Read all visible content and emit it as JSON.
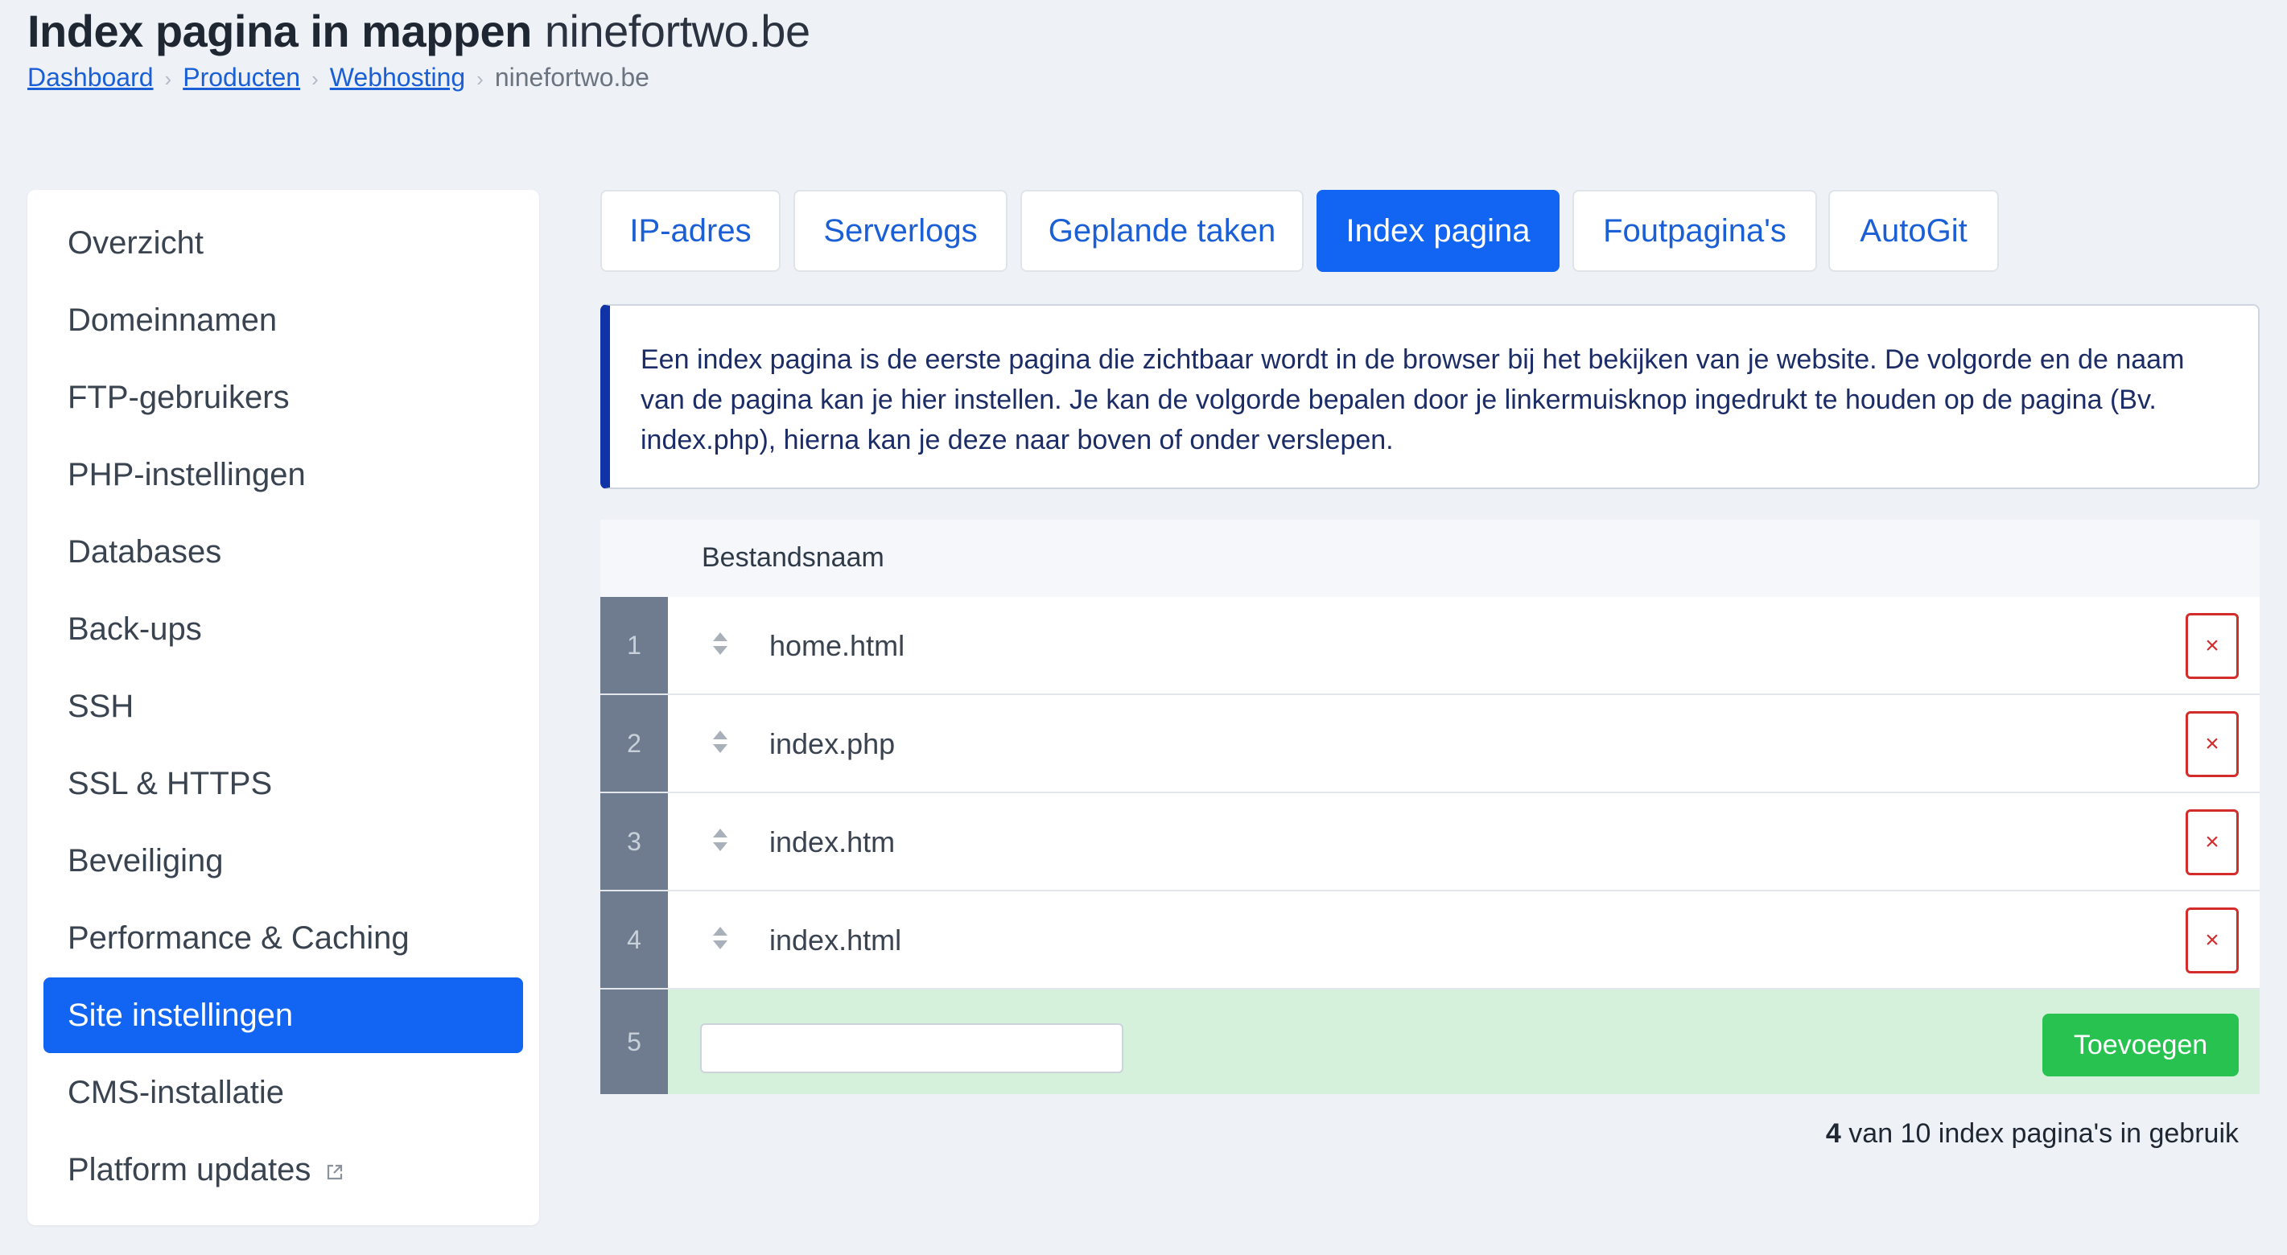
{
  "header": {
    "title": "Index pagina in mappen",
    "domain": "ninefortwo.be"
  },
  "breadcrumb": {
    "items": [
      "Dashboard",
      "Producten",
      "Webhosting"
    ],
    "current": "ninefortwo.be"
  },
  "sidebar": {
    "items": [
      {
        "label": "Overzicht"
      },
      {
        "label": "Domeinnamen"
      },
      {
        "label": "FTP-gebruikers"
      },
      {
        "label": "PHP-instellingen"
      },
      {
        "label": "Databases"
      },
      {
        "label": "Back-ups"
      },
      {
        "label": "SSH"
      },
      {
        "label": "SSL & HTTPS"
      },
      {
        "label": "Beveiliging"
      },
      {
        "label": "Performance & Caching"
      },
      {
        "label": "Site instellingen",
        "active": true
      },
      {
        "label": "CMS-installatie"
      },
      {
        "label": "Platform updates",
        "icon": "external-link-icon"
      }
    ]
  },
  "tabs": [
    {
      "label": "IP-adres"
    },
    {
      "label": "Serverlogs"
    },
    {
      "label": "Geplande taken"
    },
    {
      "label": "Index pagina",
      "active": true
    },
    {
      "label": "Foutpagina's"
    },
    {
      "label": "AutoGit"
    }
  ],
  "info_text": "Een index pagina is de eerste pagina die zichtbaar wordt in de browser bij het bekijken van je website. De volgorde en de naam van de pagina kan je hier instellen. Je kan de volgorde bepalen door je linkermuisknop ingedrukt te houden op de pagina (Bv. index.php), hierna kan je deze naar boven of onder verslepen.",
  "table": {
    "header": "Bestandsnaam",
    "rows": [
      {
        "num": "1",
        "name": "home.html",
        "delete_label": "×"
      },
      {
        "num": "2",
        "name": "index.php",
        "delete_label": "×"
      },
      {
        "num": "3",
        "name": "index.htm",
        "delete_label": "×"
      },
      {
        "num": "4",
        "name": "index.html",
        "delete_label": "×"
      }
    ],
    "add_row": {
      "num": "5",
      "input_value": "",
      "button_label": "Toevoegen"
    }
  },
  "usage": {
    "count": "4",
    "text": "van 10 index pagina's in gebruik"
  },
  "colors": {
    "accent": "#1265f2",
    "danger": "#d42b2b",
    "success": "#27c250",
    "info_border": "#1033a8",
    "row_number_bg": "#6f7c90",
    "add_row_bg": "#d5f1dc"
  }
}
